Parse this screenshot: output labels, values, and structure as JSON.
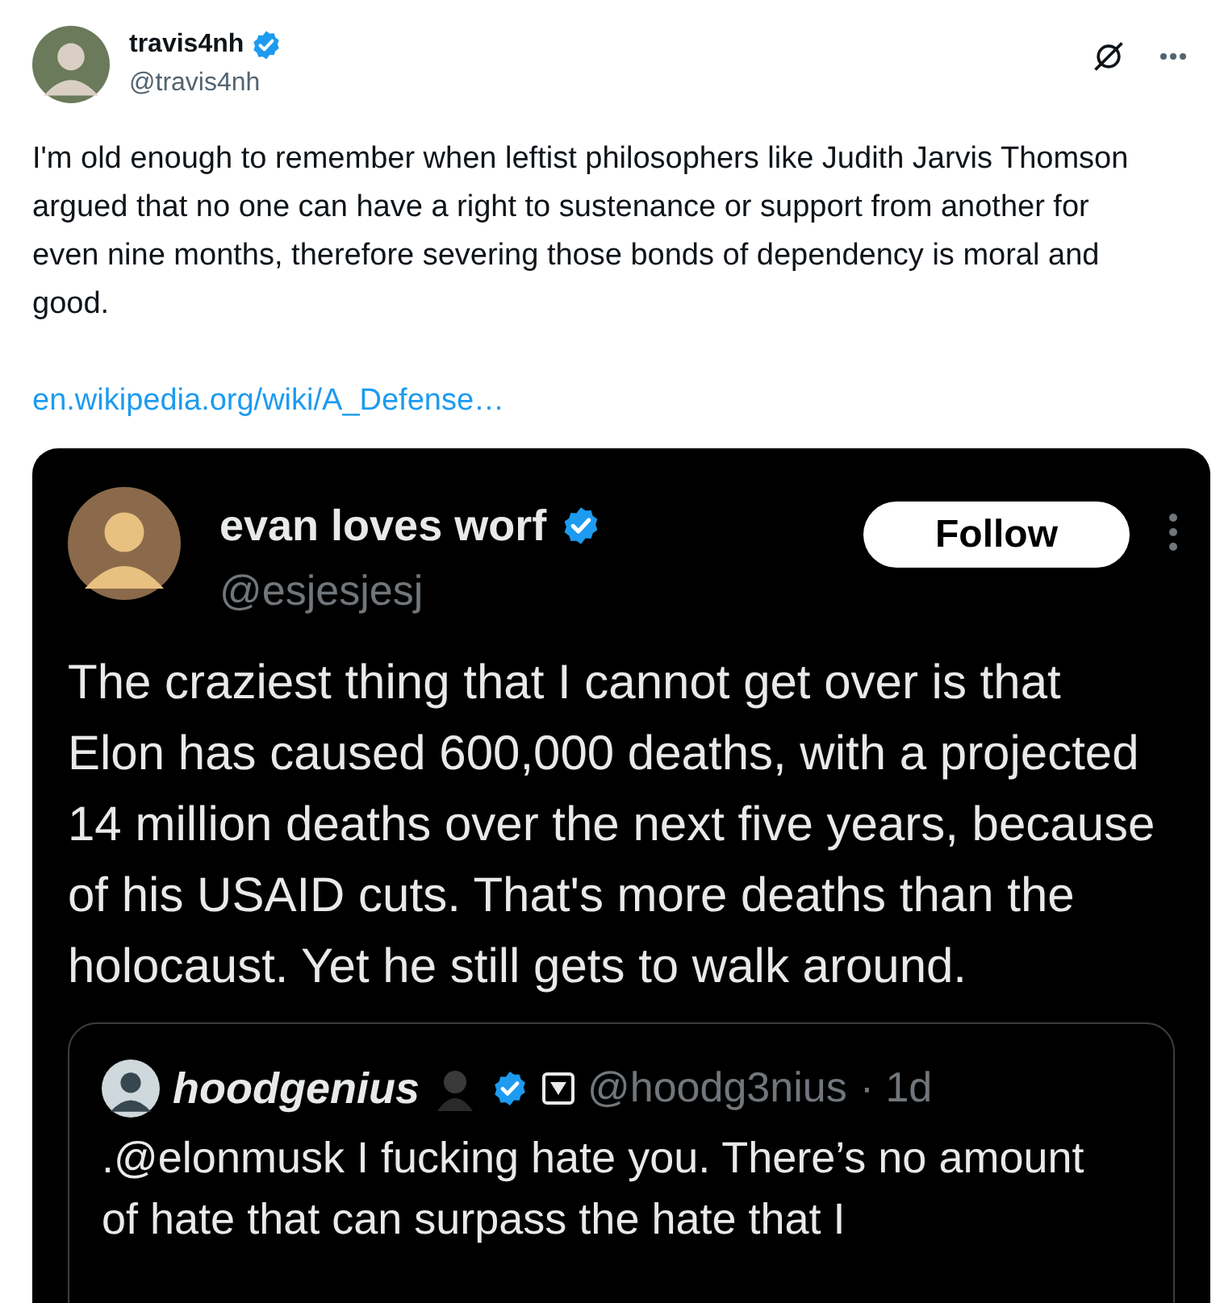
{
  "author": {
    "name": "travis4nh",
    "handle": "@travis4nh",
    "verified": true
  },
  "text": "I'm old enough to remember when leftist philosophers like Judith Jarvis Thomson argued that no one can have a right to sustenance or support from another for even nine months, therefore severing those bonds of dependency is moral and good.",
  "link": "en.wikipedia.org/wiki/A_Defense…",
  "screenshot": {
    "author": {
      "name": "evan loves worf",
      "handle": "@esjesjesj",
      "verified": true
    },
    "follow_button": "Follow",
    "text": "The craziest thing that I cannot get over is that Elon has caused 600,000 deaths, with a projected 14 million deaths over the next five years, because of his USAID cuts. That's more deaths than the holocaust. Yet he still gets to walk around.",
    "quote": {
      "name": "hoodgenius",
      "handle": "@hoodg3nius",
      "time": "· 1d",
      "verified": true,
      "text": ".@elonmusk I fucking hate you. There’s no amount of hate that can surpass the hate that I"
    }
  }
}
